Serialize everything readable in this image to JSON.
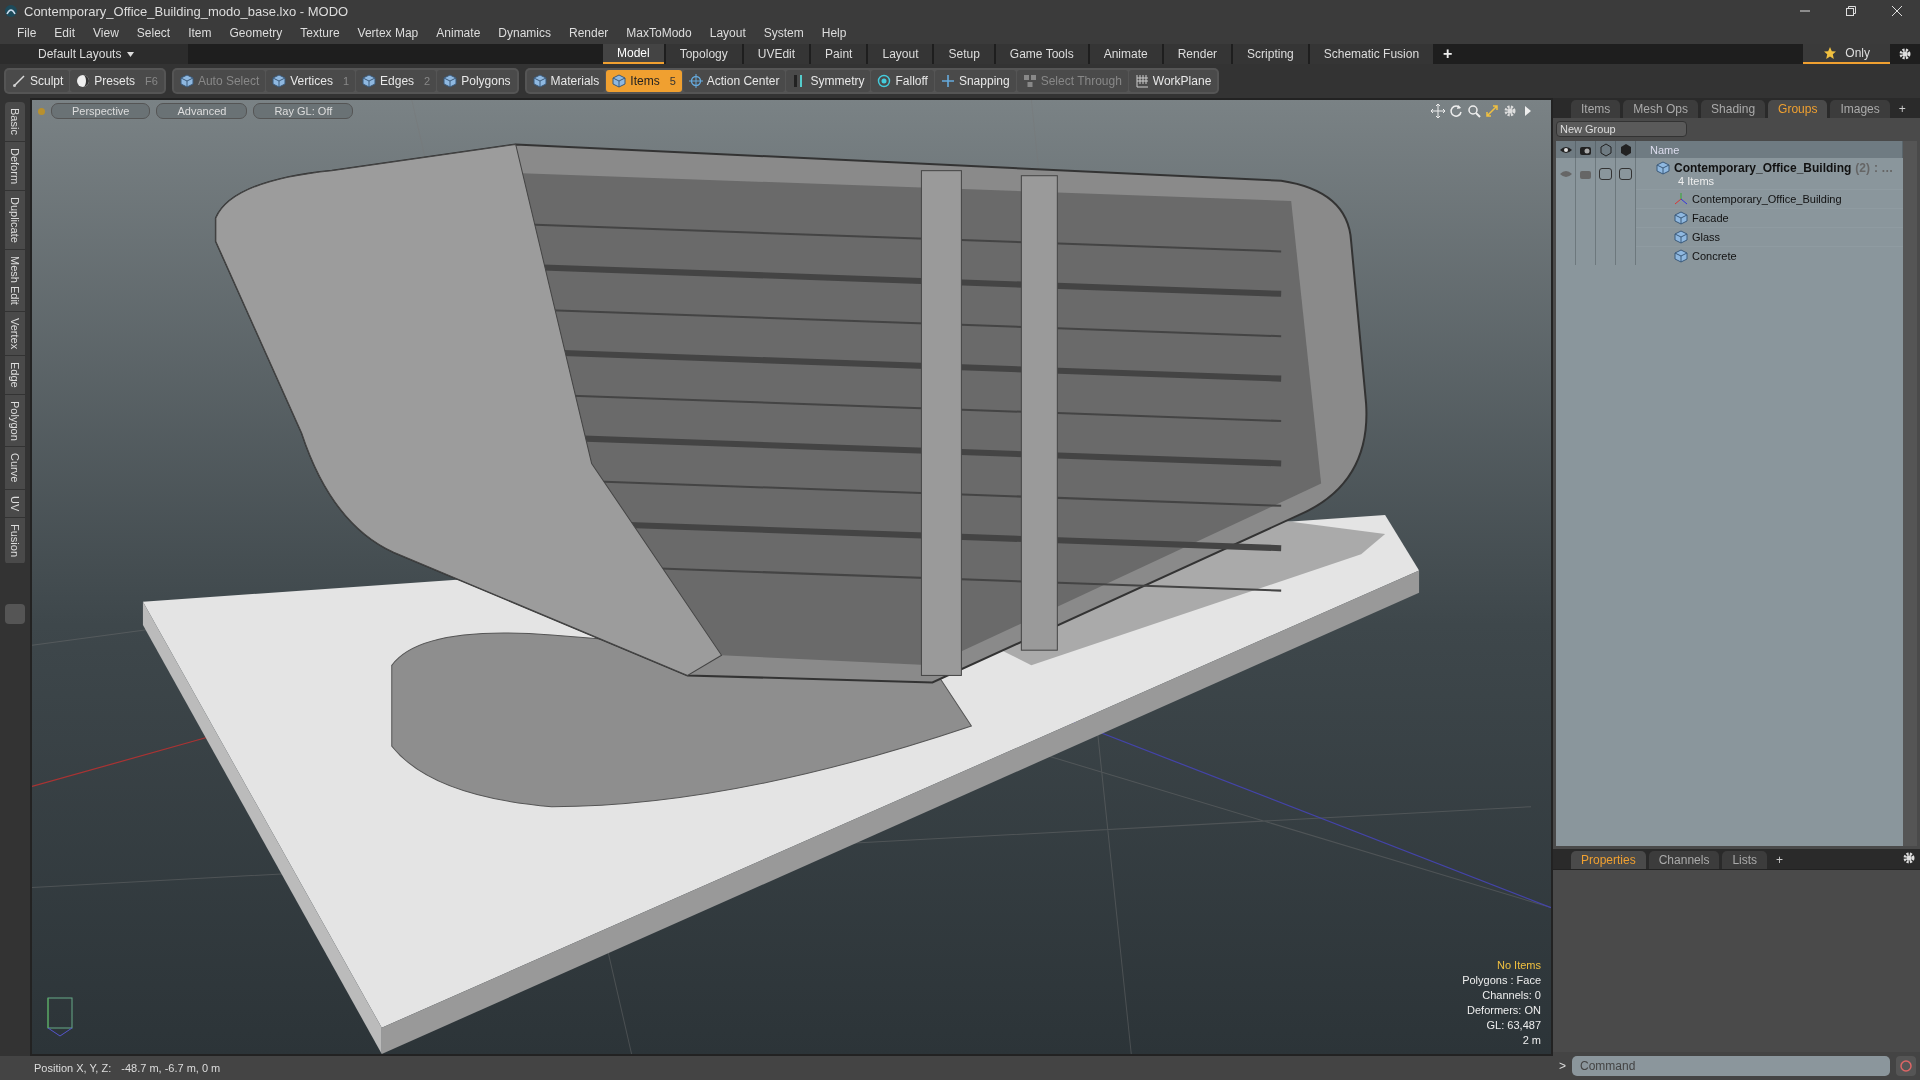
{
  "window": {
    "title": "Contemporary_Office_Building_modo_base.lxo - MODO"
  },
  "menu": [
    "File",
    "Edit",
    "View",
    "Select",
    "Item",
    "Geometry",
    "Texture",
    "Vertex Map",
    "Animate",
    "Dynamics",
    "Render",
    "MaxToModo",
    "Layout",
    "System",
    "Help"
  ],
  "layout_bar": {
    "layouts": "Default Layouts",
    "tabs": [
      {
        "label": "Model",
        "selected": true
      },
      {
        "label": "Topology",
        "selected": false
      },
      {
        "label": "UVEdit",
        "selected": false
      },
      {
        "label": "Paint",
        "selected": false
      },
      {
        "label": "Layout",
        "selected": false
      },
      {
        "label": "Setup",
        "selected": false
      },
      {
        "label": "Game Tools",
        "selected": false
      },
      {
        "label": "Animate",
        "selected": false
      },
      {
        "label": "Render",
        "selected": false
      },
      {
        "label": "Scripting",
        "selected": false
      },
      {
        "label": "Schematic Fusion",
        "selected": false
      }
    ],
    "add": "+",
    "only": "Only"
  },
  "toolbar": [
    {
      "tools": [
        {
          "label": "Sculpt",
          "selected": false,
          "disabled": false
        },
        {
          "label": "Presets",
          "shortcut": "F6",
          "selected": false,
          "disabled": false
        }
      ]
    },
    {
      "tools": [
        {
          "label": "Auto Select",
          "selected": false,
          "disabled": true
        },
        {
          "label": "Vertices",
          "shortcut": "1",
          "selected": false,
          "disabled": false
        },
        {
          "label": "Edges",
          "shortcut": "2",
          "selected": false,
          "disabled": false
        },
        {
          "label": "Polygons",
          "selected": false,
          "disabled": false
        }
      ]
    },
    {
      "tools": [
        {
          "label": "Materials",
          "selected": false,
          "disabled": false
        },
        {
          "label": "Items",
          "shortcut": "5",
          "selected": true,
          "disabled": false
        },
        {
          "label": "Action Center",
          "selected": false,
          "disabled": false
        },
        {
          "label": "Symmetry",
          "selected": false,
          "disabled": false
        },
        {
          "label": "Falloff",
          "selected": false,
          "disabled": false
        },
        {
          "label": "Snapping",
          "selected": false,
          "disabled": false
        },
        {
          "label": "Select Through",
          "selected": false,
          "disabled": true
        },
        {
          "label": "WorkPlane",
          "selected": false,
          "disabled": false
        }
      ]
    }
  ],
  "side_tabs": [
    "Basic",
    "Deform",
    "Duplicate",
    "Mesh Edit",
    "Vertex",
    "Edge",
    "Polygon",
    "Curve",
    "UV",
    "Fusion"
  ],
  "viewport": {
    "buttons": [
      "Perspective",
      "Advanced",
      "Ray GL: Off"
    ],
    "info": [
      {
        "text": "No Items",
        "kind": "highlight"
      },
      {
        "text": "Polygons : Face",
        "kind": "plain"
      },
      {
        "text": "Channels: 0",
        "kind": "plain"
      },
      {
        "text": "Deformers: ON",
        "kind": "plain"
      },
      {
        "text": "GL: 63,487",
        "kind": "plain"
      },
      {
        "text": "2 m",
        "kind": "plain"
      }
    ]
  },
  "status_bar": {
    "label": "Position X, Y, Z:",
    "value": "-48.7 m, -6.7 m, 0 m"
  },
  "groups_panel": {
    "tabs": [
      {
        "label": "Items",
        "selected": false
      },
      {
        "label": "Mesh Ops",
        "selected": false
      },
      {
        "label": "Shading",
        "selected": false
      },
      {
        "label": "Groups",
        "selected": true
      },
      {
        "label": "Images",
        "selected": false
      }
    ],
    "add": "+",
    "new_group": "New Group",
    "column": "Name",
    "group": {
      "name": "Contemporary_Office_Building",
      "locked": false,
      "selectable": false,
      "count": "(2)",
      "more": ": …",
      "subtitle": "4 Items",
      "children": [
        {
          "name": "Contemporary_Office_Building",
          "kind": "locator"
        },
        {
          "name": "Facade",
          "kind": "mesh"
        },
        {
          "name": "Glass",
          "kind": "mesh"
        },
        {
          "name": "Concrete",
          "kind": "mesh"
        }
      ]
    }
  },
  "properties_panel": {
    "tabs": [
      {
        "label": "Properties",
        "selected": true
      },
      {
        "label": "Channels",
        "selected": false
      },
      {
        "label": "Lists",
        "selected": false
      }
    ],
    "add": "+"
  },
  "command": {
    "prompt": ">",
    "placeholder": "Command"
  }
}
